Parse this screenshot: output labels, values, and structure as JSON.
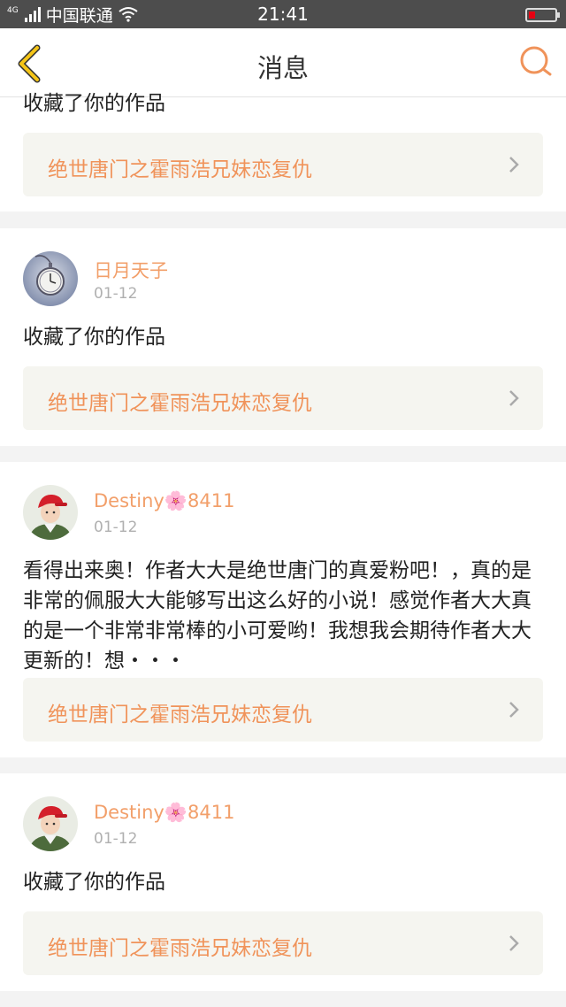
{
  "status": {
    "network_gen": "4G",
    "carrier": "中国联通",
    "time": "21:41"
  },
  "header": {
    "title": "消息"
  },
  "top_partial": {
    "action_text": "收藏了你的作品",
    "work_title": "绝世唐门之霍雨浩兄妹恋复仇"
  },
  "items": [
    {
      "username": "日月天子",
      "date": "01-12",
      "message": "收藏了你的作品",
      "work_title": "绝世唐门之霍雨浩兄妹恋复仇"
    },
    {
      "username": "Destiny🌸8411",
      "date": "01-12",
      "message": "看得出来奥！作者大大是绝世唐门的真爱粉吧！，真的是非常的佩服大大能够写出这么好的小说！感觉作者大大真的是一个非常非常棒的小可爱哟！我想我会期待作者大大更新的！想・・・",
      "work_title": "绝世唐门之霍雨浩兄妹恋复仇"
    },
    {
      "username": "Destiny🌸8411",
      "date": "01-12",
      "message": "收藏了你的作品",
      "work_title": "绝世唐门之霍雨浩兄妹恋复仇"
    }
  ],
  "colors": {
    "accent": "#f0935a",
    "back_icon": "#f5c518",
    "status_bar": "#4d4d4d"
  },
  "icons": {
    "back": "chevron-left-icon",
    "search": "search-icon",
    "arrow": "chevron-right-icon"
  }
}
